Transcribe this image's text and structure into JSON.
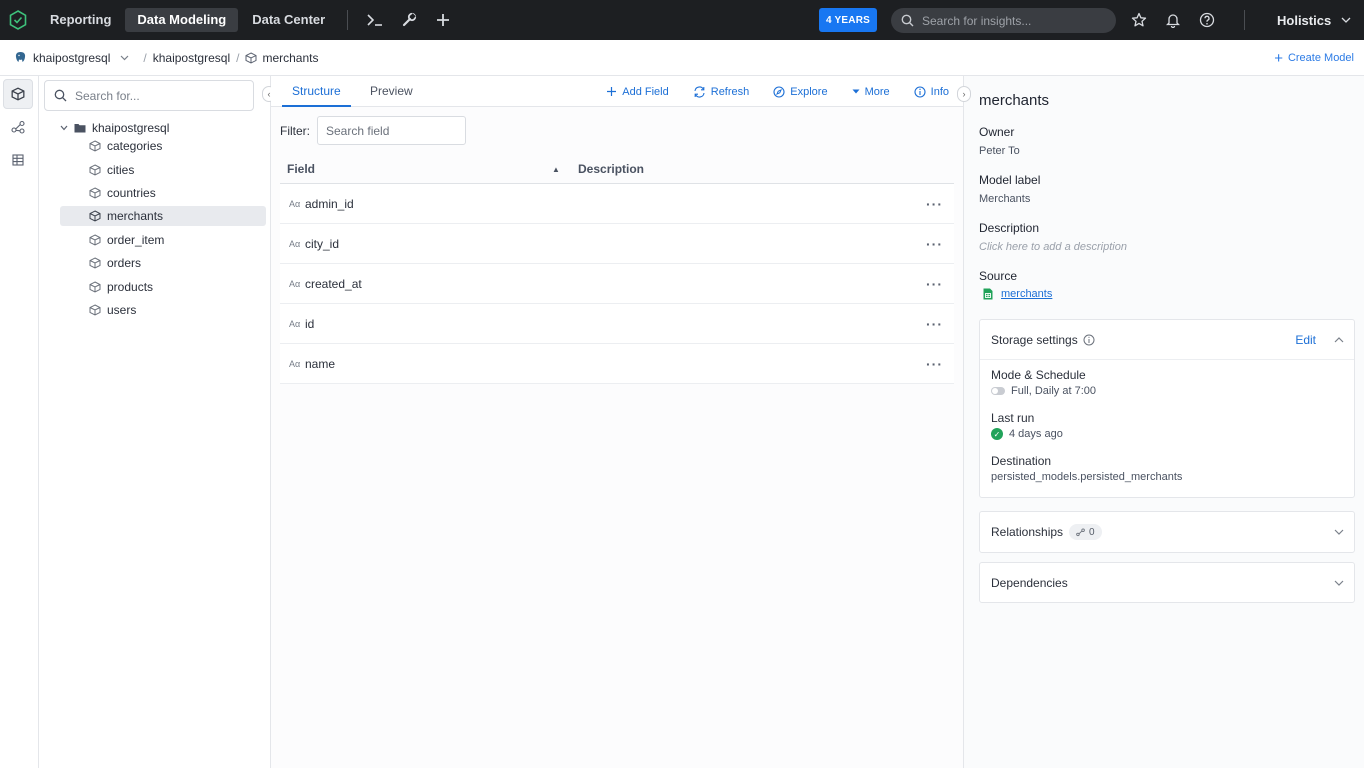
{
  "topbar": {
    "nav": [
      {
        "label": "Reporting",
        "active": false
      },
      {
        "label": "Data Modeling",
        "active": true
      },
      {
        "label": "Data Center",
        "active": false
      }
    ],
    "badge": "4 YEARS",
    "search_placeholder": "Search for insights...",
    "org_name": "Holistics"
  },
  "breadcrumb": {
    "datasource": "khaipostgresql",
    "folder": "khaipostgresql",
    "model": "merchants",
    "create_label": "Create Model"
  },
  "tree": {
    "search_placeholder": "Search for...",
    "root": "khaipostgresql",
    "items": [
      {
        "label": "categories"
      },
      {
        "label": "cities"
      },
      {
        "label": "countries"
      },
      {
        "label": "merchants",
        "selected": true
      },
      {
        "label": "order_item"
      },
      {
        "label": "orders"
      },
      {
        "label": "products"
      },
      {
        "label": "users"
      }
    ]
  },
  "main": {
    "tabs": [
      {
        "label": "Structure",
        "active": true
      },
      {
        "label": "Preview",
        "active": false
      }
    ],
    "actions": {
      "add_field": "Add Field",
      "refresh": "Refresh",
      "explore": "Explore",
      "more": "More",
      "info": "Info"
    },
    "filter_label": "Filter:",
    "filter_placeholder": "Search field",
    "columns": {
      "field": "Field",
      "description": "Description"
    },
    "type_glyph": "Aα",
    "fields": [
      {
        "name": "admin_id"
      },
      {
        "name": "city_id"
      },
      {
        "name": "created_at"
      },
      {
        "name": "id"
      },
      {
        "name": "name"
      }
    ]
  },
  "details": {
    "title": "merchants",
    "owner_label": "Owner",
    "owner": "Peter To",
    "model_label_label": "Model label",
    "model_label": "Merchants",
    "description_label": "Description",
    "description_placeholder": "Click here to add a description",
    "source_label": "Source",
    "source": "merchants",
    "storage": {
      "title": "Storage settings",
      "edit": "Edit",
      "mode_label": "Mode & Schedule",
      "mode_value": "Full, Daily at 7:00",
      "last_run_label": "Last run",
      "last_run_value": "4 days ago",
      "destination_label": "Destination",
      "destination_value": "persisted_models.persisted_merchants"
    },
    "relationships": {
      "title": "Relationships",
      "count": "0"
    },
    "dependencies": {
      "title": "Dependencies"
    }
  },
  "colors": {
    "topbar_bg": "#1d1f22",
    "accent": "#1c6fd6",
    "badge": "#1877f2",
    "success": "#21a35a"
  }
}
